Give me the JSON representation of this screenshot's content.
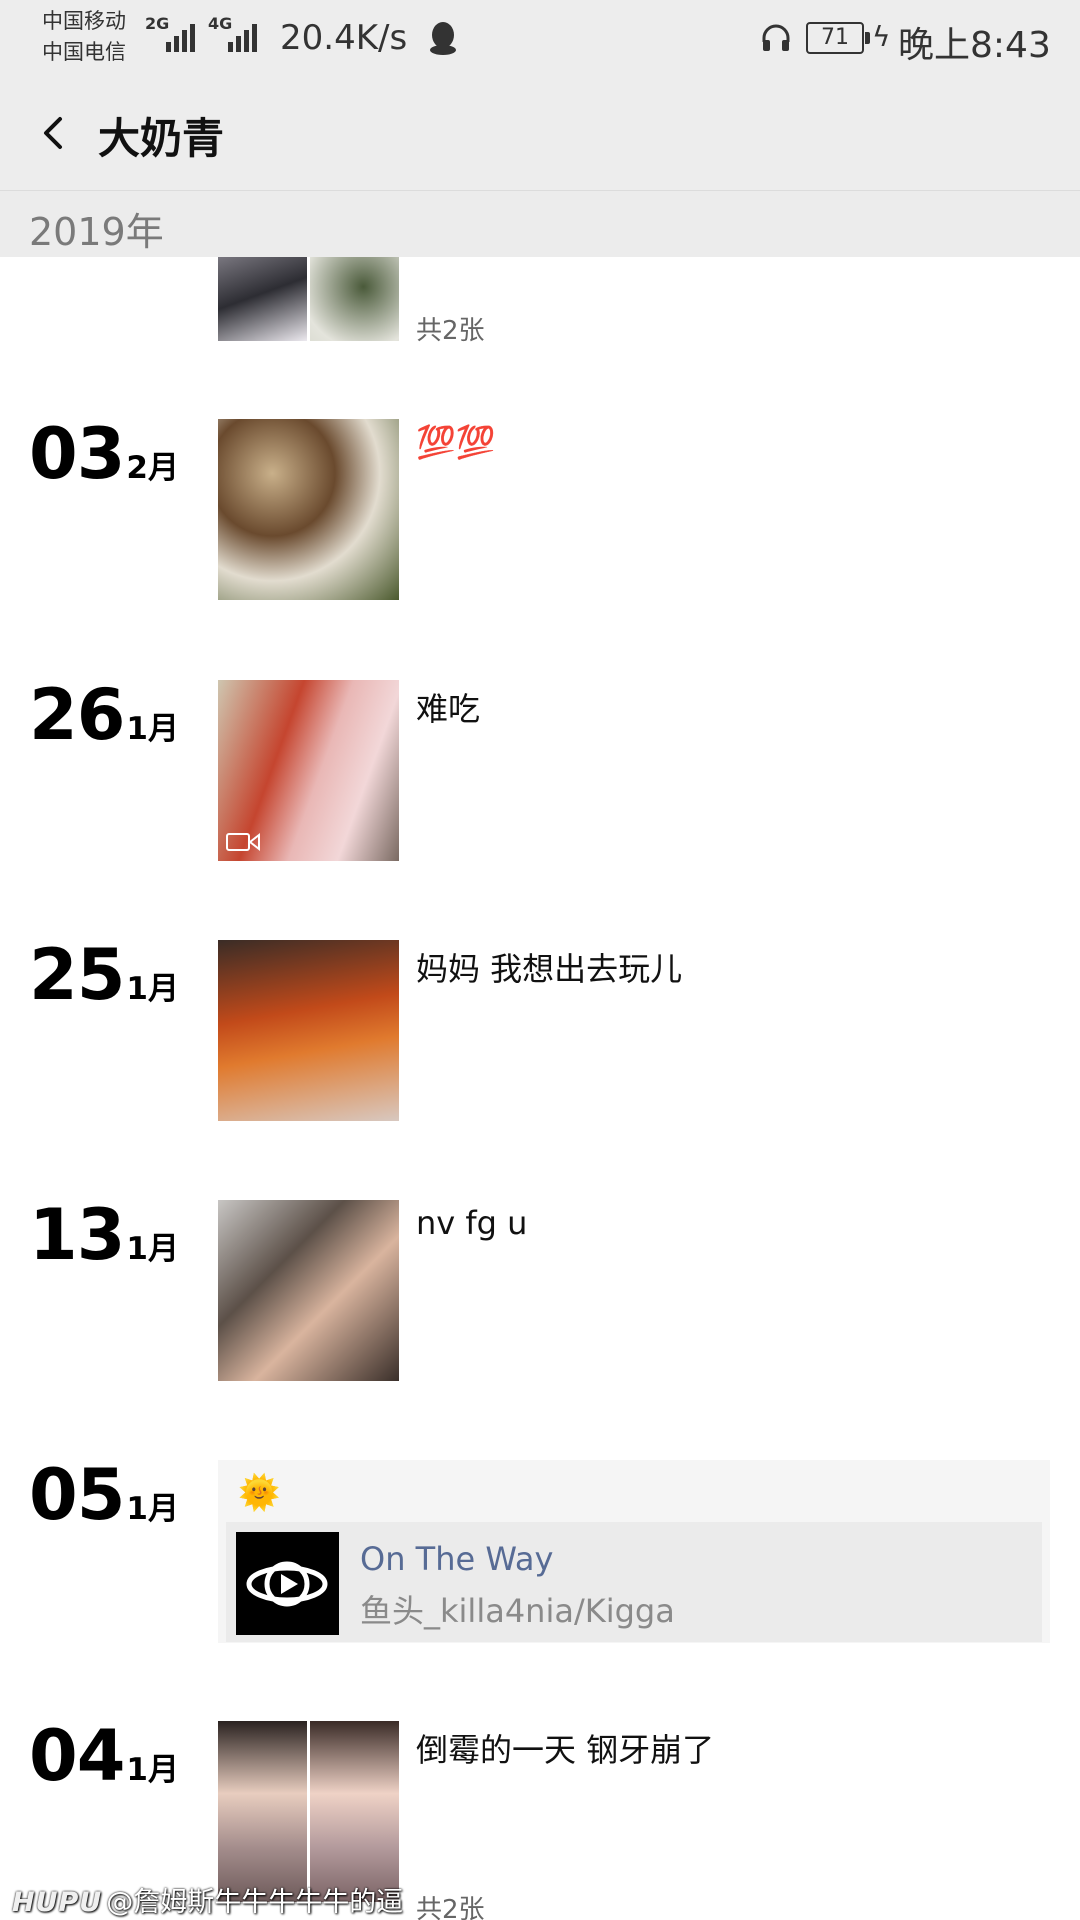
{
  "status_bar": {
    "carrier_1": "中国移动",
    "carrier_2": "中国电信",
    "net_1": "2G",
    "net_2": "4G",
    "speed": "20.4K/s",
    "battery": "71",
    "time": "晚上8:43",
    "icons": [
      "qq-penguin-icon",
      "headset-icon",
      "battery-icon",
      "charging-bolt-icon"
    ]
  },
  "header": {
    "title": "大奶青",
    "back_icon": "chevron-left-icon"
  },
  "year": "2019年",
  "entries": [
    {
      "day": "",
      "month": "",
      "caption": "",
      "count": "共2张",
      "images": 2
    },
    {
      "day": "03",
      "month": "2月",
      "caption": "💯💯",
      "images": 1
    },
    {
      "day": "26",
      "month": "1月",
      "caption": "难吃",
      "images": 1,
      "video": true
    },
    {
      "day": "25",
      "month": "1月",
      "caption": "妈妈 我想出去玩儿",
      "images": 1
    },
    {
      "day": "13",
      "month": "1月",
      "caption": "nv fg u",
      "images": 1
    },
    {
      "day": "05",
      "month": "1月",
      "caption": "🌞",
      "music": {
        "title": "On The Way",
        "artist": "鱼头_killa4nia/Kigga"
      }
    },
    {
      "day": "04",
      "month": "1月",
      "caption": "倒霉的一天 钢牙崩了",
      "count": "共2张",
      "images": 2
    }
  ],
  "watermark": {
    "logo": "HUPU",
    "text": "@詹姆斯牛牛牛牛牛的逼"
  },
  "colors": {
    "bar_bg": "#ededed",
    "link_blue": "#576b95",
    "grey_text": "#8a8a8a"
  }
}
